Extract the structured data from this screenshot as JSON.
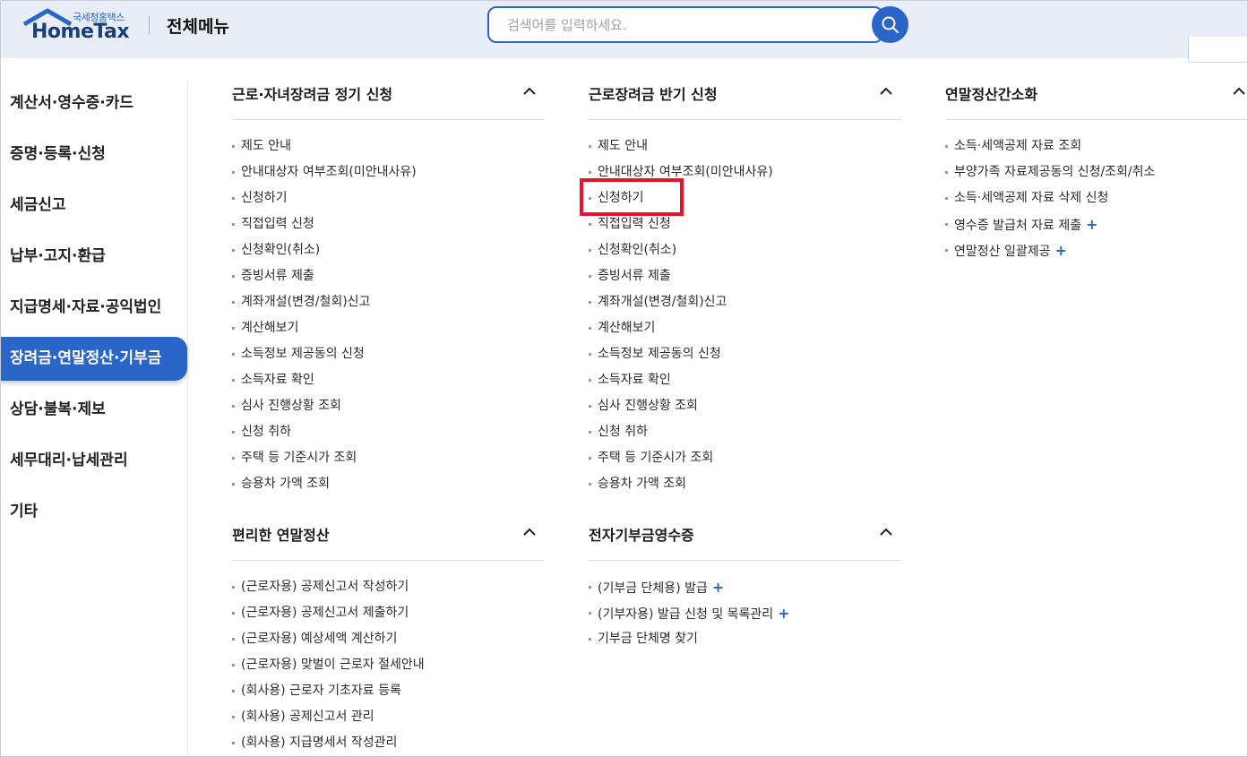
{
  "header": {
    "logo_small": "국세청홈택스",
    "logo_big": "HomeTax",
    "title": "전체메뉴",
    "search_placeholder": "검색어를 입력하세요."
  },
  "left_nav": [
    {
      "label": "계산서·영수증·카드"
    },
    {
      "label": "증명·등록·신청"
    },
    {
      "label": "세금신고"
    },
    {
      "label": "납부·고지·환급"
    },
    {
      "label": "지급명세·자료·공익법인"
    },
    {
      "label": "장려금·연말정산·기부금",
      "active": true
    },
    {
      "label": "상담·불복·제보"
    },
    {
      "label": "세무대리·납세관리"
    },
    {
      "label": "기타"
    }
  ],
  "sections": [
    {
      "title": "근로·자녀장려금 정기 신청",
      "items": [
        "제도 안내",
        "안내대상자 여부조회(미안내사유)",
        "신청하기",
        "직접입력 신청",
        "신청확인(취소)",
        "증빙서류 제출",
        "계좌개설(변경/철회)신고",
        "계산해보기",
        "소득정보 제공동의 신청",
        "소득자료 확인",
        "심사 진행상황 조회",
        "신청 취하",
        "주택 등 기준시가 조회",
        "승용차 가액 조회"
      ]
    },
    {
      "title": "근로장려금 반기 신청",
      "items": [
        "제도 안내",
        "안내대상자 여부조회(미안내사유)",
        "신청하기",
        "직접입력 신청",
        "신청확인(취소)",
        "증빙서류 제출",
        "계좌개설(변경/철회)신고",
        "계산해보기",
        "소득정보 제공동의 신청",
        "소득자료 확인",
        "심사 진행상황 조회",
        "신청 취하",
        "주택 등 기준시가 조회",
        "승용차 가액 조회"
      ]
    },
    {
      "title": "연말정산간소화",
      "items": [
        "소득·세액공제 자료 조회",
        "부양가족 자료제공동의 신청/조회/취소",
        "소득·세액공제 자료 삭제 신청",
        "영수증 발급처 자료 제출",
        "연말정산 일괄제공"
      ],
      "plus": [
        false,
        false,
        false,
        true,
        true
      ]
    },
    {
      "title": "편리한 연말정산",
      "items": [
        "(근로자용) 공제신고서 작성하기",
        "(근로자용) 공제신고서 제출하기",
        "(근로자용) 예상세액 계산하기",
        "(근로자용) 맞벌이 근로자 절세안내",
        "(회사용) 근로자 기초자료 등록",
        "(회사용) 공제신고서 관리",
        "(회사용) 지급명세서 작성관리"
      ]
    },
    {
      "title": "전자기부금영수증",
      "items": [
        "(기부금 단체용) 발급",
        "(기부자용) 발급 신청 및 목록관리",
        "기부금 단체명 찾기"
      ],
      "plus": [
        true,
        true,
        false
      ]
    }
  ],
  "plus_symbol": "+",
  "colors": {
    "accent": "#2a66c8",
    "header_bg": "#e9eef6",
    "highlight": "#e8132b"
  }
}
